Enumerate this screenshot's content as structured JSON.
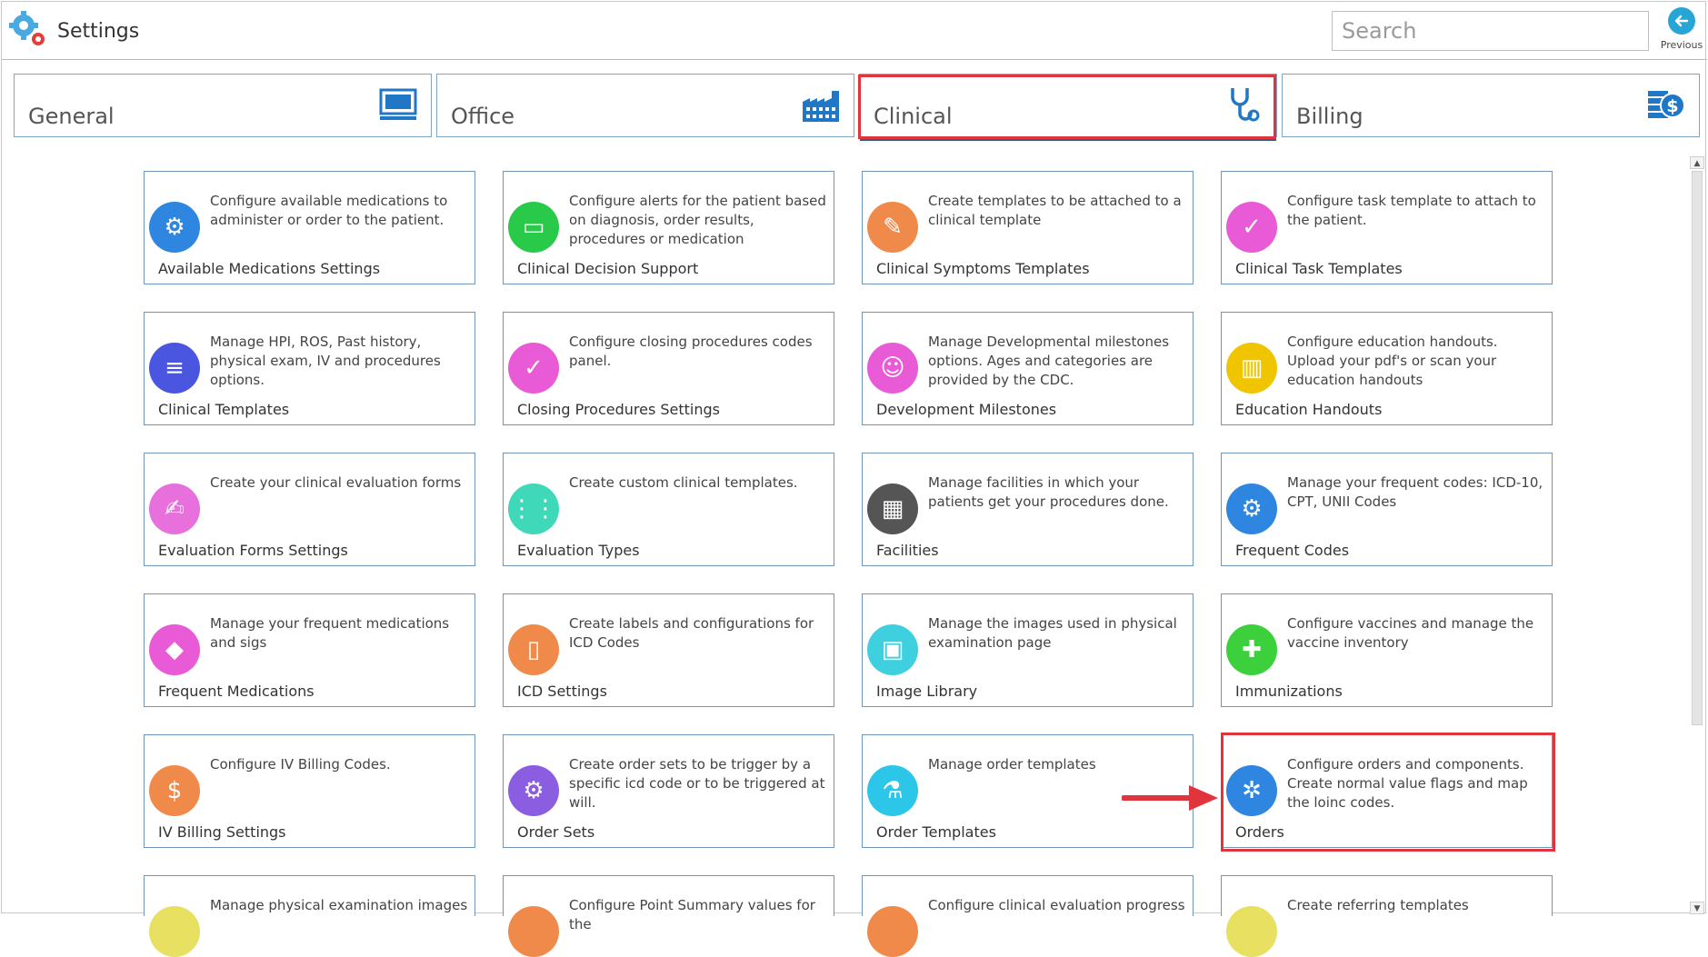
{
  "app": {
    "title": "Settings"
  },
  "search": {
    "placeholder": "Search"
  },
  "previous": {
    "label": "Previous"
  },
  "tabs": [
    {
      "label": "General",
      "icon": "monitor-icon"
    },
    {
      "label": "Office",
      "icon": "building-icon"
    },
    {
      "label": "Clinical",
      "icon": "stethoscope-icon",
      "active": true
    },
    {
      "label": "Billing",
      "icon": "billing-icon"
    }
  ],
  "cards": [
    {
      "title": "Available Medications Settings",
      "desc": "Configure available medications to administer or order to the patient.",
      "icon": "medication-settings-icon",
      "color": "#2e86e0"
    },
    {
      "title": "Clinical Decision Support",
      "desc": "Configure alerts for the patient based on diagnosis, order results, procedures or medication",
      "icon": "laptop-icon",
      "color": "#29c94a"
    },
    {
      "title": "Clinical Symptoms Templates",
      "desc": "Create templates to be attached to a clinical template",
      "icon": "edit-list-icon",
      "color": "#f08a4b"
    },
    {
      "title": "Clinical Task Templates",
      "desc": "Configure task template to attach to the patient.",
      "icon": "clipboard-check-icon",
      "color": "#e85ad6"
    },
    {
      "title": "Clinical Templates",
      "desc": "Manage HPI, ROS, Past history, physical exam, IV and procedures options.",
      "icon": "list-icon",
      "color": "#4a55e0"
    },
    {
      "title": "Closing Procedures Settings",
      "desc": "Configure closing procedures codes panel.",
      "icon": "clipboard-check-icon",
      "color": "#e85ad6"
    },
    {
      "title": "Development Milestones",
      "desc": "Manage Developmental milestones options. Ages and categories are provided by the CDC.",
      "icon": "baby-icon",
      "color": "#e85ad6"
    },
    {
      "title": "Education Handouts",
      "desc": "Configure education handouts. Upload your pdf's or scan your education handouts",
      "icon": "books-icon",
      "color": "#f1c400"
    },
    {
      "title": "Evaluation Forms Settings",
      "desc": "Create your clinical evaluation forms",
      "icon": "form-icon",
      "color": "#e870dc"
    },
    {
      "title": "Evaluation Types",
      "desc": "Create custom clinical templates.",
      "icon": "grid-list-icon",
      "color": "#3fd8b8"
    },
    {
      "title": "Facilities",
      "desc": "Manage facilities in which your patients get your procedures done.",
      "icon": "facility-add-icon",
      "color": "#555555"
    },
    {
      "title": "Frequent Codes",
      "desc": "Manage your frequent codes: ICD-10, CPT, UNII Codes",
      "icon": "codes-settings-icon",
      "color": "#2e86e0"
    },
    {
      "title": "Frequent Medications",
      "desc": "Manage your frequent medications and sigs",
      "icon": "pill-icon",
      "color": "#e85ad6"
    },
    {
      "title": "ICD Settings",
      "desc": "Create labels and configurations for ICD Codes",
      "icon": "clipboard-icon",
      "color": "#f08a4b"
    },
    {
      "title": "Image Library",
      "desc": "Manage the images used in physical examination page",
      "icon": "image-folder-icon",
      "color": "#3fd0e0"
    },
    {
      "title": "Immunizations",
      "desc": "Configure vaccines and manage the vaccine inventory",
      "icon": "syringe-icon",
      "color": "#3cd13c"
    },
    {
      "title": "IV Billing Settings",
      "desc": "Configure IV Billing Codes.",
      "icon": "dollar-export-icon",
      "color": "#f08a4b"
    },
    {
      "title": "Order Sets",
      "desc": "Create order sets to be trigger by a specific icd code or to be triggered at will.",
      "icon": "document-settings-icon",
      "color": "#8b5de0"
    },
    {
      "title": "Order Templates",
      "desc": "Manage order templates",
      "icon": "flask-icon",
      "color": "#2bc6e8"
    },
    {
      "title": "Orders",
      "desc": "Configure orders and components. Create normal value flags and map the loinc codes.",
      "icon": "microscope-icon",
      "color": "#2e86e0"
    },
    {
      "title": "",
      "desc": "Manage physical examination images",
      "icon": "partial-icon",
      "color": "#e8e060"
    },
    {
      "title": "",
      "desc": "Configure Point Summary values for the",
      "icon": "partial-icon",
      "color": "#f08a4b"
    },
    {
      "title": "",
      "desc": "Configure clinical evaluation progress",
      "icon": "partial-icon",
      "color": "#f08a4b"
    },
    {
      "title": "",
      "desc": "Create referring templates",
      "icon": "partial-icon",
      "color": "#e8e060"
    }
  ]
}
